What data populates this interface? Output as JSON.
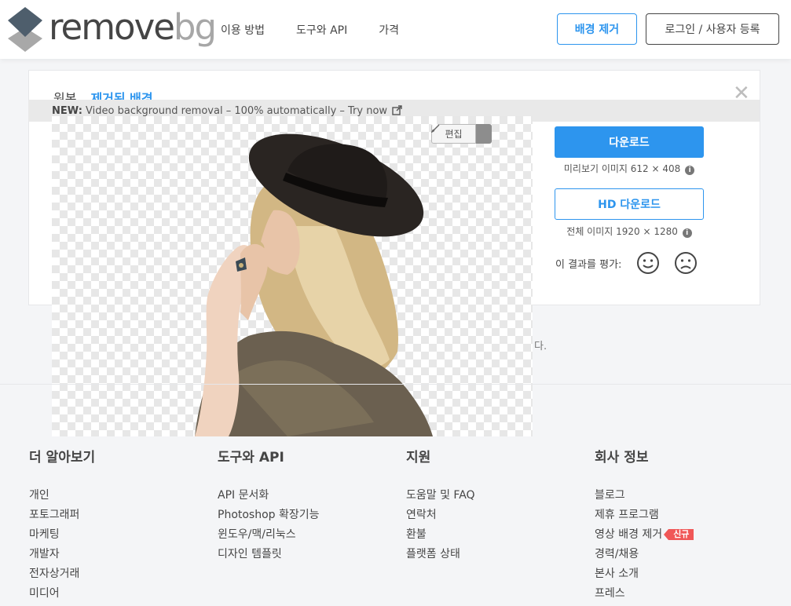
{
  "header": {
    "logo_primary": "remove",
    "logo_secondary": "bg",
    "nav": [
      "이용 방법",
      "도구와 API",
      "가격"
    ],
    "remove_bg_button": "배경 제거",
    "login_button": "로그인 / 사용자 등록"
  },
  "card": {
    "tab_original": "원본",
    "tab_removed": "제거된 배경",
    "close": "✕",
    "promo_bold": "NEW:",
    "promo_text": "Video background removal – 100% automatically – Try now",
    "edit_label": "편집",
    "download_button": "다운로드",
    "preview_info": "미리보기 이미지 612 × 408",
    "hd_download_button": "HD 다운로드",
    "hd_info": "전체 이미지 1920 × 1280",
    "rate_label": "이 결과를 평가:",
    "info_icon": "i"
  },
  "stray_text": "다.",
  "footer": {
    "columns": [
      {
        "title": "더 알아보기",
        "items": [
          "개인",
          "포토그래퍼",
          "마케팅",
          "개발자",
          "전자상거래",
          "미디어"
        ]
      },
      {
        "title": "도구와 API",
        "items": [
          "API 문서화",
          "Photoshop 확장기능",
          "윈도우/맥/리눅스",
          "디자인 템플릿"
        ]
      },
      {
        "title": "지원",
        "items": [
          "도움말 및 FAQ",
          "연락처",
          "환불",
          "플랫폼 상태"
        ]
      },
      {
        "title": "회사 정보",
        "items": [
          "블로그",
          "제휴 프로그램",
          "영상 배경 제거",
          "경력/채용",
          "본사 소개",
          "프레스"
        ],
        "badge": "신규"
      }
    ]
  },
  "colors": {
    "accent": "#2d95ee",
    "text": "#454545",
    "badge": "#f05757"
  },
  "icons": [
    "logo-icon",
    "close-icon",
    "external-link-icon",
    "brush-icon",
    "caret-down-icon",
    "info-icon",
    "smile-icon",
    "frown-icon"
  ]
}
